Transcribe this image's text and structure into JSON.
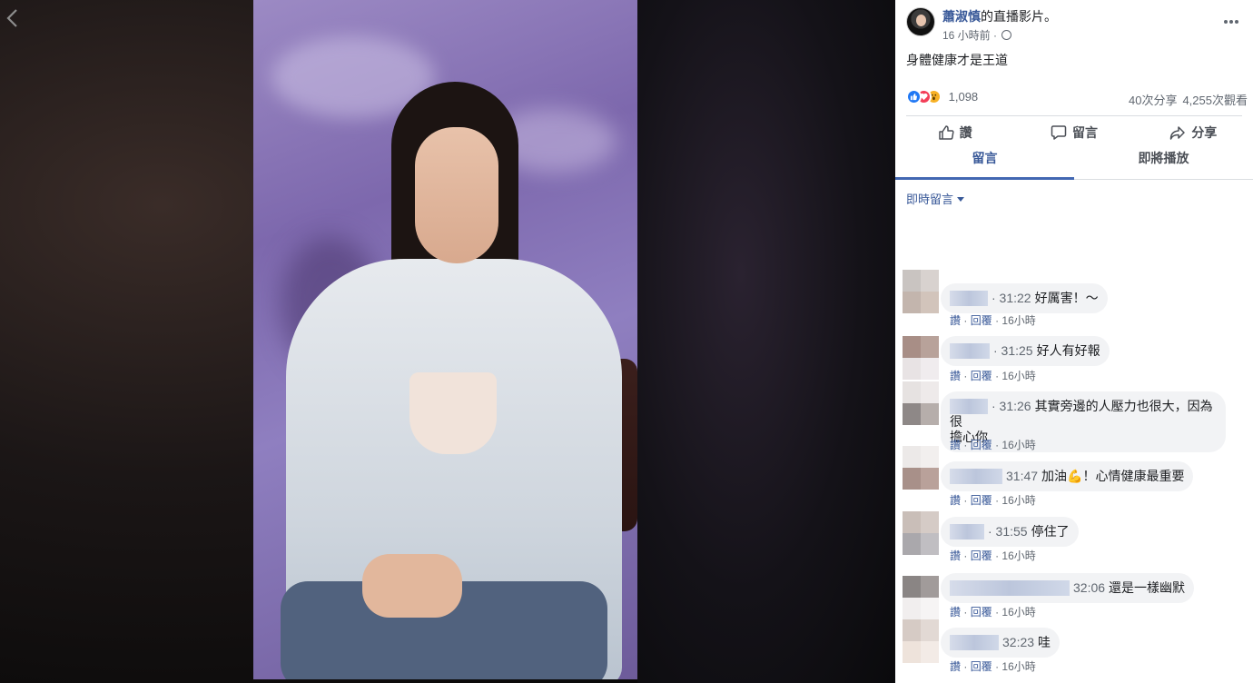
{
  "post": {
    "author_name": "蕭淑慎",
    "author_rest": "的直播影片。",
    "time_ago": "16 小時前 ·",
    "text": "身體健康才是王道",
    "reaction_count": "1,098",
    "shares": "40次分享",
    "views": "4,255次觀看"
  },
  "actions": {
    "like": "讚",
    "comment": "留言",
    "share": "分享"
  },
  "tabs": {
    "comments": "留言",
    "up_next": "即將播放"
  },
  "filter_label": "即時留言",
  "comment_actions": {
    "like": "讚",
    "separator": "·",
    "reply": "回覆"
  },
  "comments": [
    {
      "time": "· 31:22",
      "text": "好厲害！～",
      "age": "16小時"
    },
    {
      "time": "· 31:25",
      "text": "好人有好報",
      "age": "16小時"
    },
    {
      "time": "· 31:26",
      "text": "其實旁邊的人壓力也很大，因為很",
      "text2": "擔心你",
      "age": "16小時"
    },
    {
      "time": "31:47",
      "text": "加油💪！心情健康最重要",
      "age": "16小時"
    },
    {
      "time": "· 31:55",
      "text": "停住了",
      "age": "16小時"
    },
    {
      "time": "32:06",
      "text": "還是一樣幽默",
      "age": "16小時"
    },
    {
      "time": "32:23",
      "text": "哇",
      "age": "16小時"
    }
  ],
  "colors": {
    "link": "#385898",
    "tab_active": "#4267b2",
    "bubble_bg": "#f2f3f5"
  }
}
